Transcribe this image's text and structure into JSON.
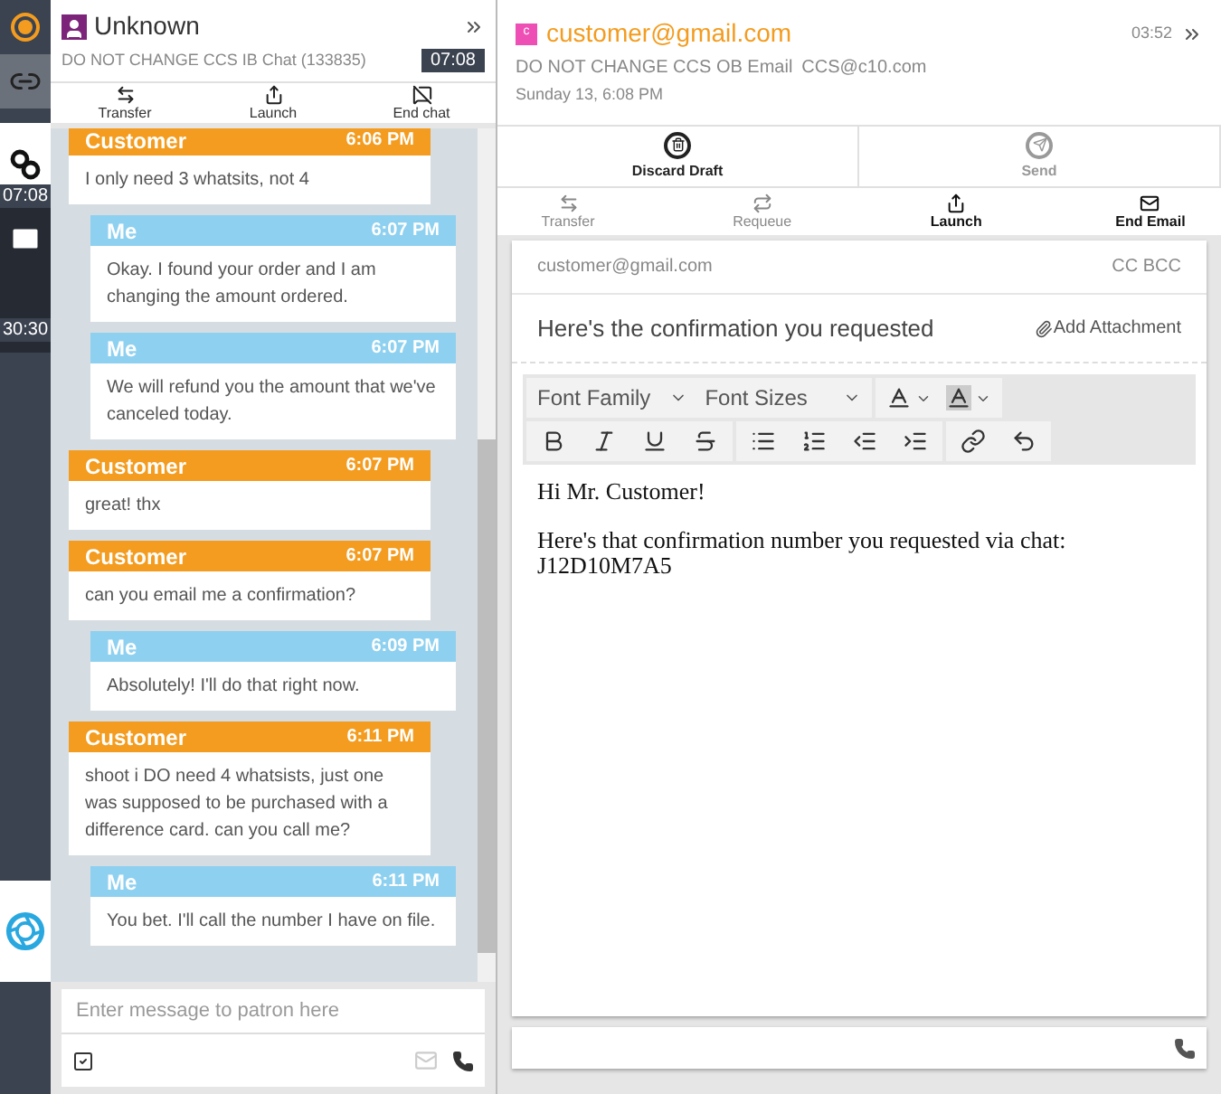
{
  "rail": {
    "items": [
      {
        "kind": "status"
      },
      {
        "kind": "link"
      },
      {
        "kind": "chat",
        "timer": "07:08"
      },
      {
        "kind": "email",
        "timer": "30:30"
      },
      {
        "kind": "logo"
      }
    ]
  },
  "chat": {
    "contact": "Unknown",
    "queue": "DO NOT CHANGE CCS IB Chat (133835)",
    "timer": "07:08",
    "actions": [
      {
        "label": "Transfer",
        "kind": "transfer"
      },
      {
        "label": "Launch",
        "kind": "launch"
      },
      {
        "label": "End chat",
        "kind": "end-chat"
      }
    ],
    "messages": [
      {
        "sender": "Customer",
        "kind": "customer",
        "time": "6:06 PM",
        "text": "I only need 3 whatsits, not 4"
      },
      {
        "sender": "Me",
        "kind": "agent",
        "time": "6:07 PM",
        "text": "Okay. I found your order and I am changing the amount ordered."
      },
      {
        "sender": "Me",
        "kind": "agent",
        "time": "6:07 PM",
        "text": "We will refund you the amount that we've canceled today."
      },
      {
        "sender": "Customer",
        "kind": "customer",
        "time": "6:07 PM",
        "text": "great! thx"
      },
      {
        "sender": "Customer",
        "kind": "customer",
        "time": "6:07 PM",
        "text": "can you email me a confirmation?"
      },
      {
        "sender": "Me",
        "kind": "agent",
        "time": "6:09 PM",
        "text": "Absolutely! I'll do that right now."
      },
      {
        "sender": "Customer",
        "kind": "customer",
        "time": "6:11 PM",
        "text": "shoot i DO need 4 whatsists, just one was supposed to be purchased with a difference card. can you call me?"
      },
      {
        "sender": "Me",
        "kind": "agent",
        "time": "6:11 PM",
        "text": "You bet. I'll call the number I have on file."
      }
    ],
    "input": {
      "placeholder": "Enter message to patron here"
    }
  },
  "email": {
    "avatar_letter": "c",
    "from": "customer@gmail.com",
    "queue": "DO NOT CHANGE CCS OB Email",
    "address": "CCS@c10.com",
    "date": "Sunday 13, 6:08 PM",
    "timer": "03:52",
    "draft_actions": [
      {
        "label": "Discard Draft",
        "kind": "discard",
        "disabled": false
      },
      {
        "label": "Send",
        "kind": "send",
        "disabled": true
      }
    ],
    "actions": [
      {
        "label": "Transfer",
        "kind": "transfer",
        "disabled": true
      },
      {
        "label": "Requeue",
        "kind": "requeue",
        "disabled": true
      },
      {
        "label": "Launch",
        "kind": "launch",
        "disabled": false
      },
      {
        "label": "End Email",
        "kind": "end-email",
        "disabled": false
      }
    ],
    "to": "customer@gmail.com",
    "cc_bcc": "CC BCC",
    "subject": "Here's the confirmation you requested",
    "attachment": "Add Attachment",
    "editor": {
      "font_family": "Font Family",
      "font_sizes": "Font Sizes"
    },
    "body": [
      [
        "Hi Mr. Customer!"
      ],
      [
        "Here's that confirmation number you requested via chat:",
        "J12D10M7A5"
      ]
    ]
  }
}
